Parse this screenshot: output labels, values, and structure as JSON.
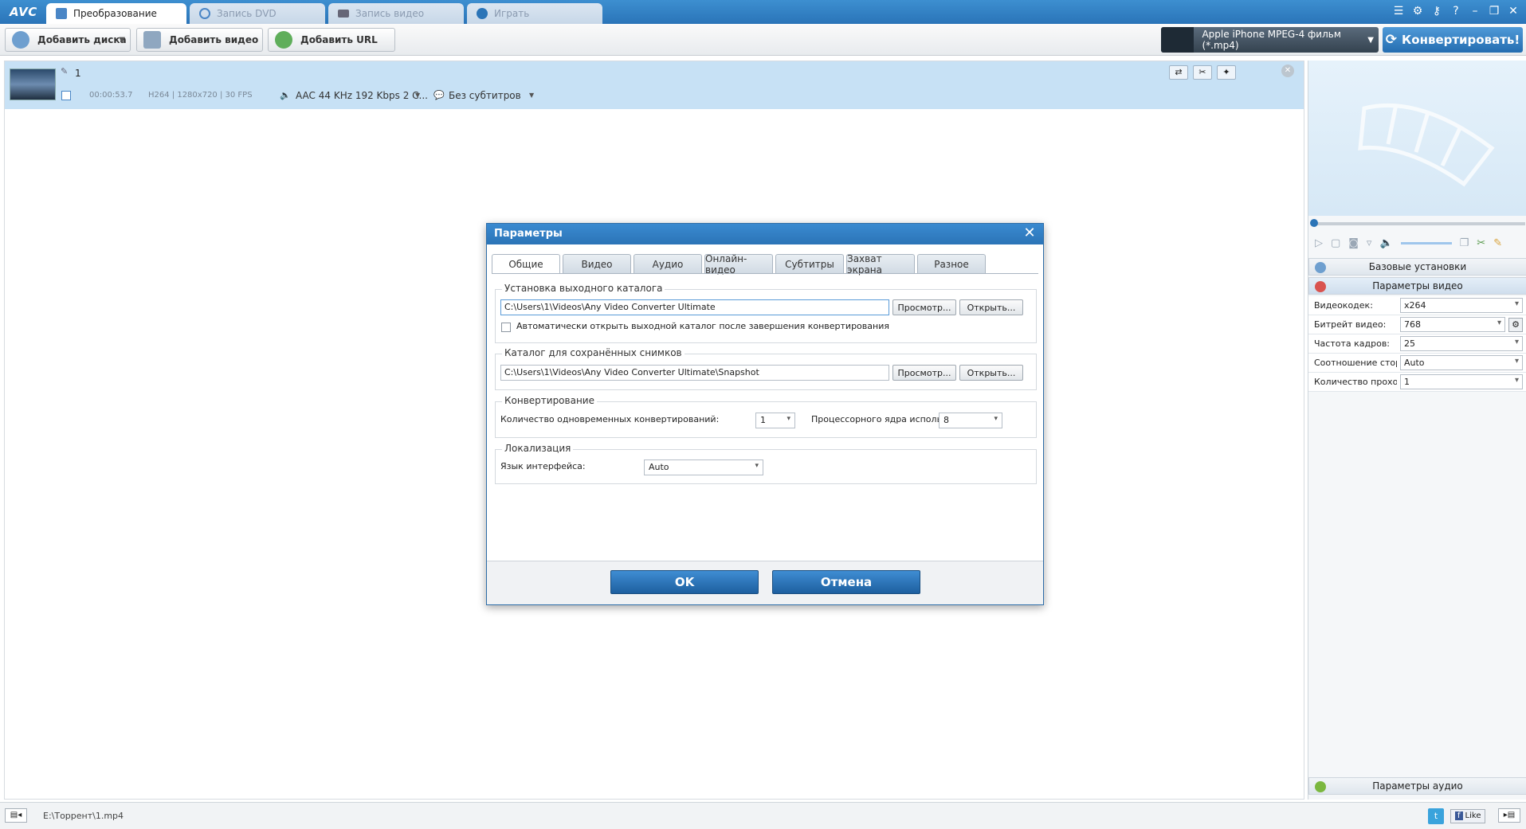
{
  "app": {
    "logo": "AVC",
    "tabs": [
      {
        "label": "Преобразование"
      },
      {
        "label": "Запись DVD"
      },
      {
        "label": "Запись видео"
      },
      {
        "label": "Играть"
      }
    ]
  },
  "toolbar": {
    "add_disc": "Добавить диска",
    "add_video": "Добавить видео",
    "add_url": "Добавить URL",
    "profile": "Apple iPhone MPEG-4 фильм (*.mp4)",
    "convert": "Конвертировать!"
  },
  "file_item": {
    "name": "1",
    "duration": "00:00:53.7",
    "video_info": "H264 | 1280x720 | 30 FPS",
    "audio_info": "AAC 44 KHz 192 Kbps 2 C...",
    "subtitles": "Без субтитров"
  },
  "right_panel": {
    "basic_settings": "Базовые установки",
    "video_params": "Параметры видео",
    "audio_params": "Параметры аудио",
    "rows": [
      {
        "label": "Видеокодек:",
        "value": "x264"
      },
      {
        "label": "Битрейт видео:",
        "value": "768"
      },
      {
        "label": "Частота кадров:",
        "value": "25"
      },
      {
        "label": "Соотношение стор",
        "value": "Auto"
      },
      {
        "label": "Количество проход",
        "value": "1"
      }
    ]
  },
  "status": {
    "path": "E:\\Торрент\\1.mp4",
    "like": "Like"
  },
  "dialog": {
    "title": "Параметры",
    "tabs": [
      "Общие",
      "Видео",
      "Аудио",
      "Онлайн-видео",
      "Субтитры",
      "Захват экрана",
      "Разное"
    ],
    "output_group": "Установка выходного каталога",
    "output_path": "C:\\Users\\1\\Videos\\Any Video Converter Ultimate",
    "browse": "Просмотр...",
    "open": "Открыть...",
    "auto_open": "Автоматически открыть выходной каталог после завершения конвертирования",
    "snapshot_group": "Каталог для сохранённых снимков",
    "snapshot_path": "C:\\Users\\1\\Videos\\Any Video Converter Ultimate\\Snapshot",
    "convert_group": "Конвертирование",
    "simultaneous_label": "Количество одновременных конвертирований:",
    "simultaneous_value": "1",
    "cores_label": "Процессорного ядра исполь",
    "cores_value": "8",
    "locale_group": "Локализация",
    "language_label": "Язык интерфейса:",
    "language_value": "Auto",
    "ok": "OK",
    "cancel": "Отмена"
  },
  "colors": {
    "accent": "#2b74b7",
    "title_bar": "#3a8ad0",
    "selected_row": "#c7e1f5"
  }
}
